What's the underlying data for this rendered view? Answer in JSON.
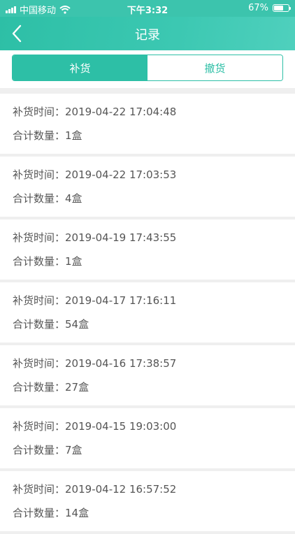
{
  "status_bar": {
    "carrier": "中国移动",
    "time": "下午3:32",
    "battery_percent": "67%",
    "battery_level": 0.67
  },
  "nav": {
    "title": "记录",
    "back_icon": "chevron-left-icon"
  },
  "tabs": [
    {
      "label": "补货",
      "active": true
    },
    {
      "label": "撤货",
      "active": false
    }
  ],
  "records": [
    {
      "time_label": "补货时间：",
      "time": "2019-04-22 17:04:48",
      "qty_label": "合计数量：",
      "qty": "1盒"
    },
    {
      "time_label": "补货时间：",
      "time": "2019-04-22 17:03:53",
      "qty_label": "合计数量：",
      "qty": "4盒"
    },
    {
      "time_label": "补货时间：",
      "time": "2019-04-19 17:43:55",
      "qty_label": "合计数量：",
      "qty": "1盒"
    },
    {
      "time_label": "补货时间：",
      "time": "2019-04-17 17:16:11",
      "qty_label": "合计数量：",
      "qty": "54盒"
    },
    {
      "time_label": "补货时间：",
      "time": "2019-04-16 17:38:57",
      "qty_label": "合计数量：",
      "qty": "27盒"
    },
    {
      "time_label": "补货时间：",
      "time": "2019-04-15 19:03:00",
      "qty_label": "合计数量：",
      "qty": "7盒"
    },
    {
      "time_label": "补货时间：",
      "time": "2019-04-12 16:57:52",
      "qty_label": "合计数量：",
      "qty": "14盒"
    }
  ],
  "colors": {
    "accent": "#2dbfa6",
    "background": "#efefef",
    "text": "#555555"
  }
}
